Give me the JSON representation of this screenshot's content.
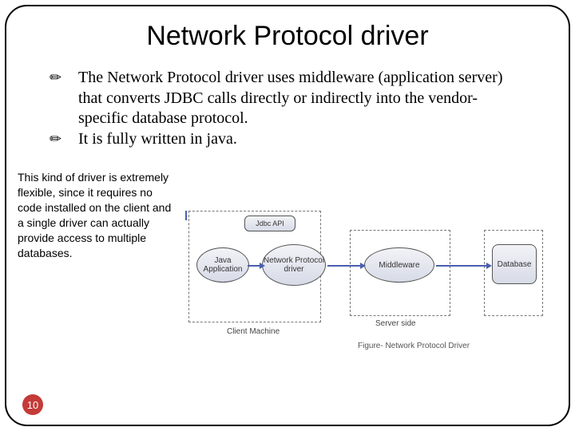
{
  "title": "Network Protocol driver",
  "bullets": [
    "The Network Protocol driver uses middleware (application server) that converts JDBC calls directly or indirectly into the vendor-specific database protocol.",
    "It is fully written in java."
  ],
  "bullet_glyph": "✏",
  "note": "This kind of driver is extremely flexible, since it requires no code installed on the client and a single driver can actually provide access to multiple databases.",
  "diagram": {
    "jdbc_api": "Jdbc API",
    "java_app": "Java Application",
    "network_protocol_driver": "Network Protocol driver",
    "middleware": "Middleware",
    "database": "Database",
    "client_label": "Client Machine",
    "server_label": "Server side",
    "caption": "Figure- Network Protocol Driver"
  },
  "page_number": "10"
}
